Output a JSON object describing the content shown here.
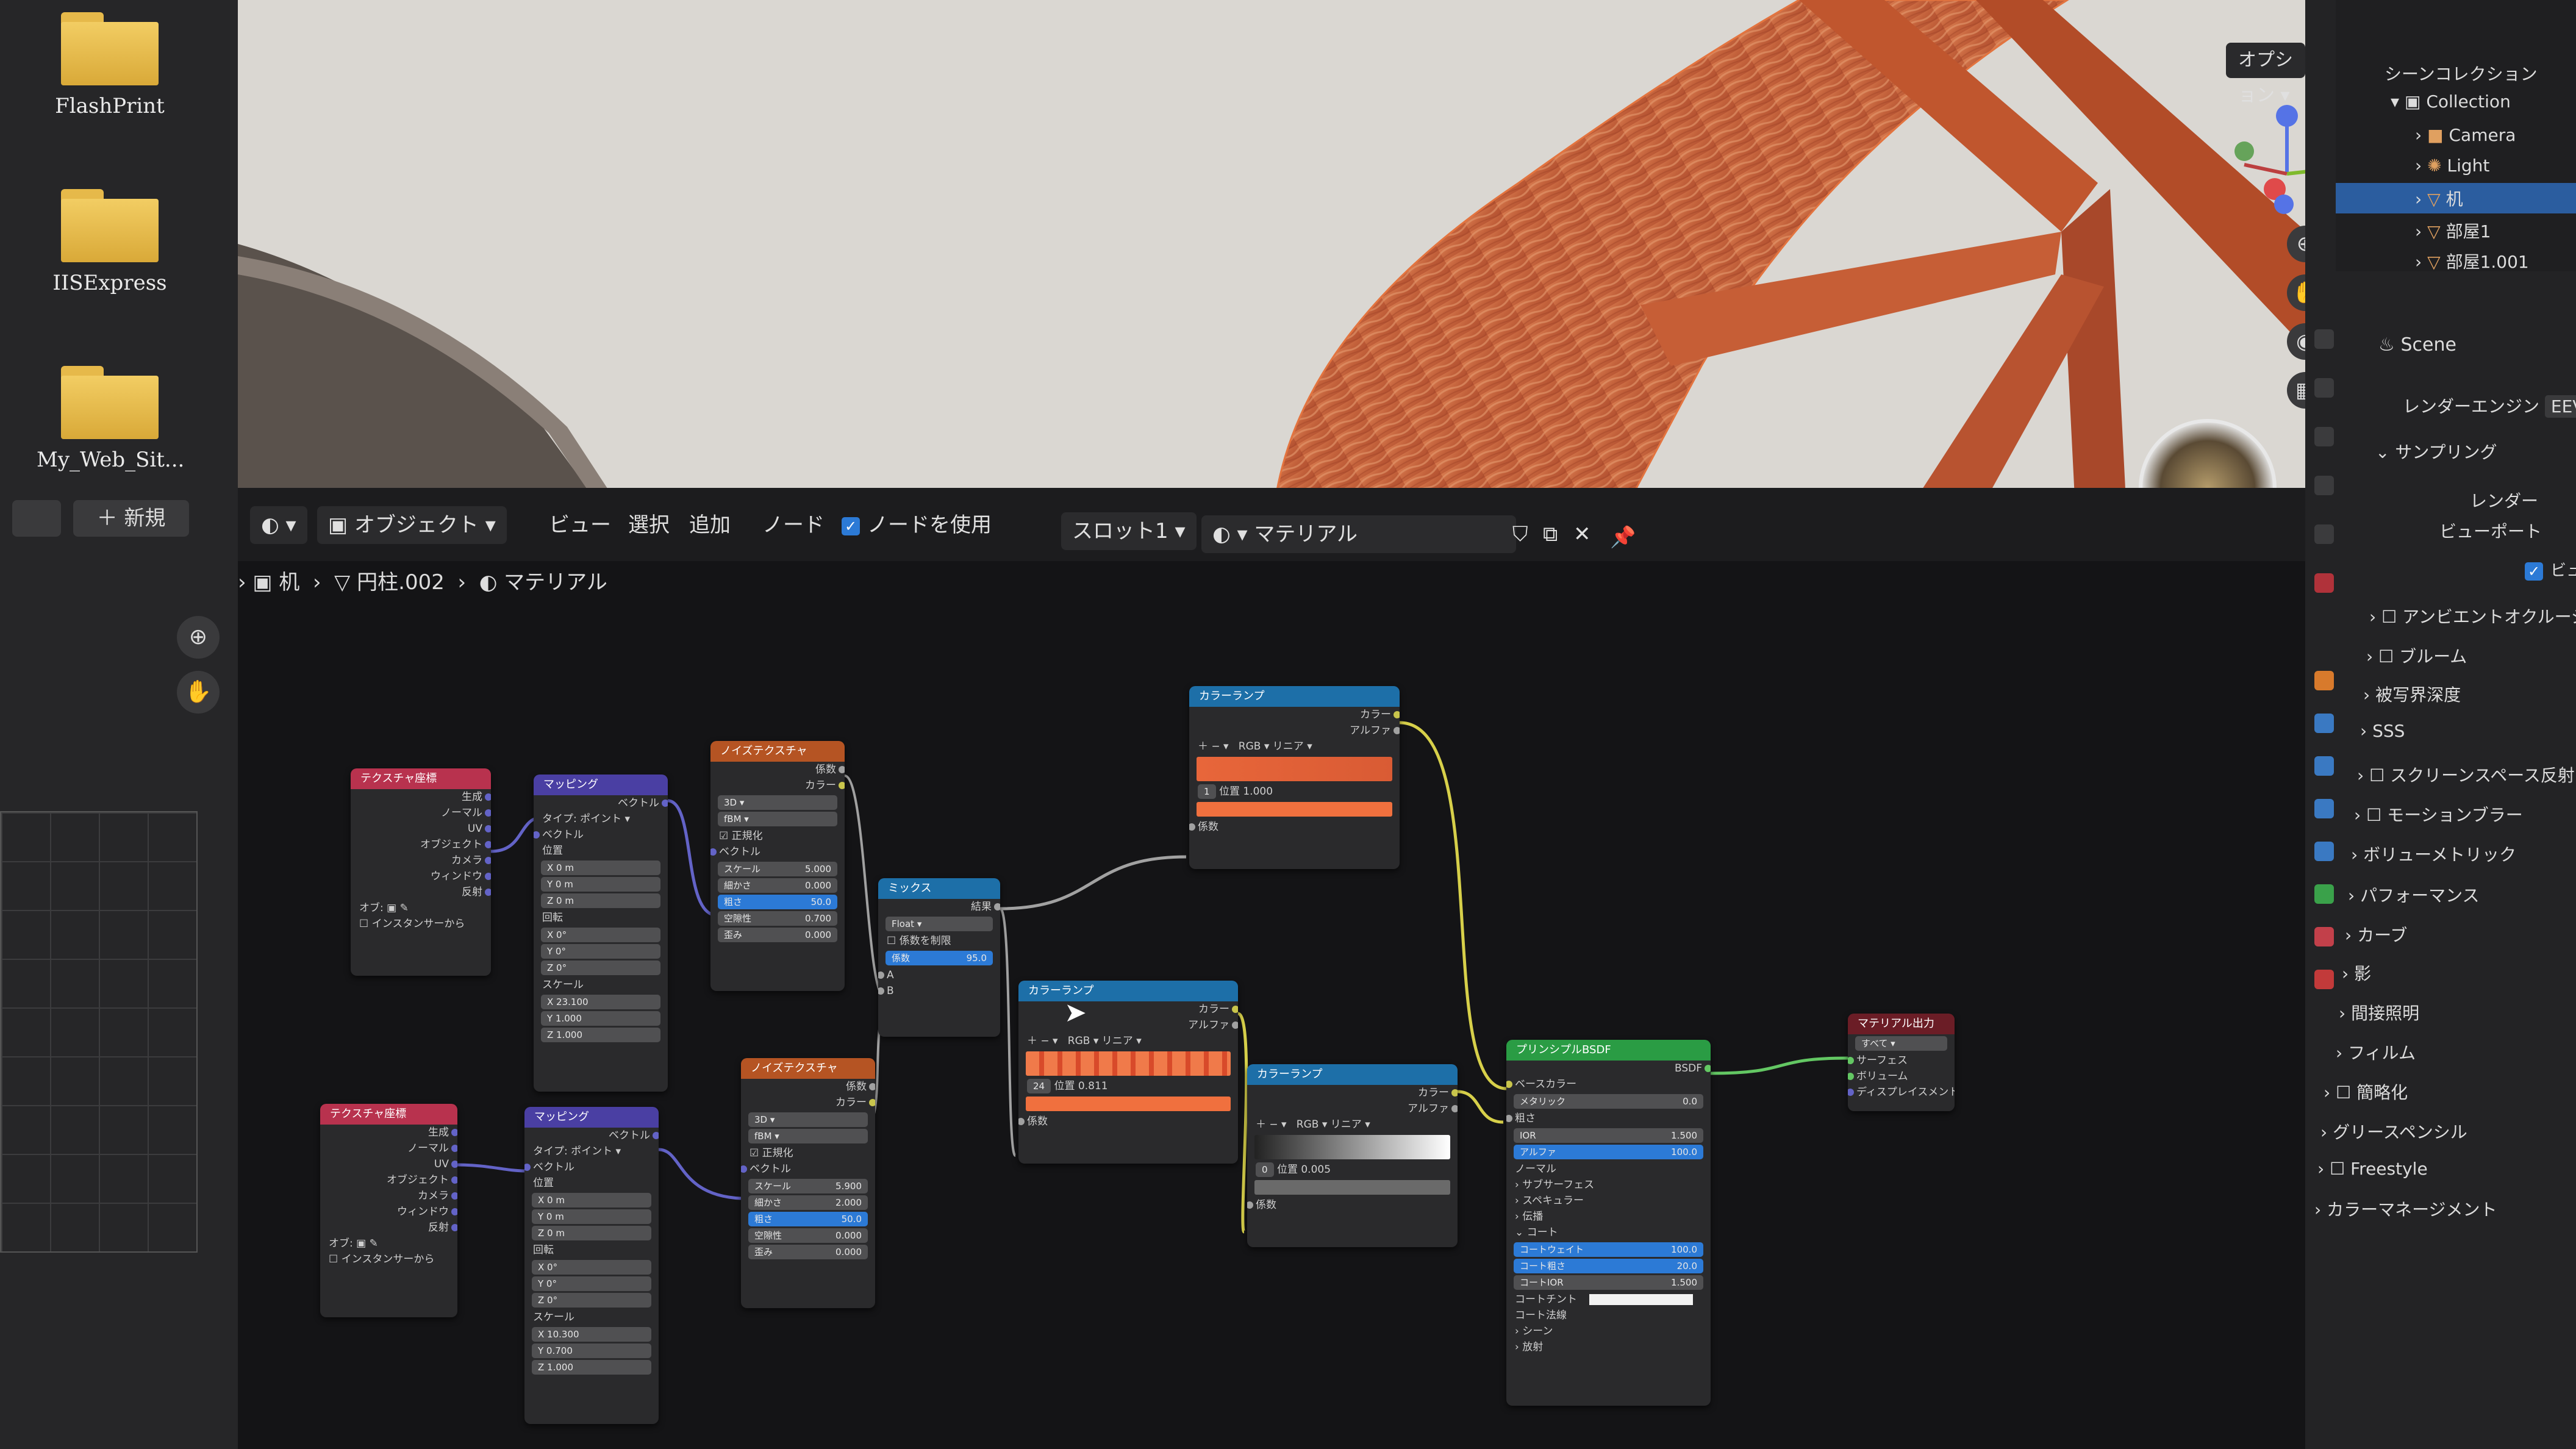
{
  "desktop": {
    "icons": [
      {
        "label": "FlashPrint"
      },
      {
        "label": "IISExpress"
      },
      {
        "label": "My_Web_Sit..."
      }
    ]
  },
  "viewport": {
    "options_label": "オプション"
  },
  "node_editor": {
    "new_label": "新規",
    "mode_label": "オブジェクト",
    "menus": [
      "ビュー",
      "選択",
      "追加",
      "ノード"
    ],
    "use_nodes_label": "ノードを使用",
    "slot_label": "スロット1",
    "material_name": "マテリアル",
    "breadcrumb": [
      "机",
      "円柱.002",
      "マテリアル"
    ]
  },
  "nodes": {
    "tex_coord_1": {
      "title": "テクスチャ座標",
      "outputs": [
        "生成",
        "ノーマル",
        "UV",
        "オブジェクト",
        "カメラ",
        "ウィンドウ",
        "反射"
      ],
      "object_label": "オブ",
      "instancer_label": "インスタンサーから"
    },
    "mapping_1": {
      "title": "マッピング",
      "out": "ベクトル",
      "type_label": "タイプ",
      "type_value": "ポイント",
      "vector_label": "ベクトル",
      "location_label": "位置",
      "loc": [
        "X  0 m",
        "Y  0 m",
        "Z  0 m"
      ],
      "rotation_label": "回転",
      "rot": [
        "X  0°",
        "Y  0°",
        "Z  0°"
      ],
      "scale_label": "スケール",
      "scale": [
        "X  23.100",
        "Y  1.000",
        "Z  1.000"
      ]
    },
    "noise_1": {
      "title": "ノイズテクスチャ",
      "outputs": [
        "係数",
        "カラー"
      ],
      "dim": "3D",
      "type": "fBM",
      "normalize": "正規化",
      "vector": "ベクトル",
      "fields": [
        {
          "label": "スケール",
          "value": "5.000"
        },
        {
          "label": "細かさ",
          "value": "0.000"
        },
        {
          "label": "粗さ",
          "value": "50.0",
          "hl": true
        },
        {
          "label": "空隙性",
          "value": "0.700"
        },
        {
          "label": "歪み",
          "value": "0.000"
        }
      ]
    },
    "mix": {
      "title": "ミックス",
      "out": "結果",
      "type": "Float",
      "clamp": "係数を制限",
      "factor_label": "係数",
      "factor_value": "95.0",
      "inputs": [
        "A",
        "B"
      ]
    },
    "ramp_top": {
      "title": "カラーランプ",
      "outputs": [
        "カラー",
        "アルファ"
      ],
      "mode": "RGB",
      "interp": "リニア",
      "index": "1",
      "pos_label": "位置",
      "pos": "1.000",
      "in": "係数"
    },
    "ramp_mid": {
      "title": "カラーランプ",
      "outputs": [
        "カラー",
        "アルファ"
      ],
      "mode": "RGB",
      "interp": "リニア",
      "index": "24",
      "pos_label": "位置",
      "pos": "0.811",
      "in": "係数"
    },
    "ramp_right": {
      "title": "カラーランプ",
      "outputs": [
        "カラー",
        "アルファ"
      ],
      "mode": "RGB",
      "interp": "リニア",
      "index": "0",
      "pos_label": "位置",
      "pos": "0.005",
      "in": "係数"
    },
    "tex_coord_2": {
      "title": "テクスチャ座標",
      "outputs": [
        "生成",
        "ノーマル",
        "UV",
        "オブジェクト",
        "カメラ",
        "ウィンドウ",
        "反射"
      ],
      "object_label": "オブ",
      "instancer_label": "インスタンサーから"
    },
    "mapping_2": {
      "title": "マッピング",
      "out": "ベクトル",
      "type_label": "タイプ",
      "type_value": "ポイント",
      "vector_label": "ベクトル",
      "location_label": "位置",
      "loc": [
        "X  0 m",
        "Y  0 m",
        "Z  0 m"
      ],
      "rotation_label": "回転",
      "rot": [
        "X  0°",
        "Y  0°",
        "Z  0°"
      ],
      "scale_label": "スケール",
      "scale": [
        "X  10.300",
        "Y  0.700",
        "Z  1.000"
      ]
    },
    "noise_2": {
      "title": "ノイズテクスチャ",
      "outputs": [
        "係数",
        "カラー"
      ],
      "dim": "3D",
      "type": "fBM",
      "normalize": "正規化",
      "vector": "ベクトル",
      "fields": [
        {
          "label": "スケール",
          "value": "5.900"
        },
        {
          "label": "細かさ",
          "value": "2.000"
        },
        {
          "label": "粗さ",
          "value": "50.0",
          "hl": true
        },
        {
          "label": "空隙性",
          "value": "0.000"
        },
        {
          "label": "歪み",
          "value": "0.000"
        }
      ]
    },
    "bsdf": {
      "title": "プリンシプルBSDF",
      "out": "BSDF",
      "base_color": "ベースカラー",
      "fields": [
        {
          "label": "メタリック",
          "value": "0.0"
        },
        {
          "label": "粗さ",
          "value": ""
        },
        {
          "label": "IOR",
          "value": "1.500"
        },
        {
          "label": "アルファ",
          "value": "100.0",
          "hl": true
        }
      ],
      "sections": [
        "ノーマル",
        "サブサーフェス",
        "スペキュラー",
        "伝播",
        "コート"
      ],
      "coat": [
        {
          "label": "コートウェイト",
          "value": "100.0",
          "hl": true
        },
        {
          "label": "コート粗さ",
          "value": "20.0",
          "hl": true
        },
        {
          "label": "コートIOR",
          "value": "1.500"
        }
      ],
      "coat_tint": "コートチント",
      "coat_normal": "コート法線",
      "more": [
        "シーン",
        "放射"
      ]
    },
    "output": {
      "title": "マテリアル出力",
      "target": "すべて",
      "inputs": [
        "サーフェス",
        "ボリューム",
        "ディスプレイスメント"
      ]
    }
  },
  "outliner": {
    "title": "シーンコレクション",
    "items": [
      {
        "label": "Collection"
      },
      {
        "label": "Camera"
      },
      {
        "label": "Light"
      },
      {
        "label": "机"
      },
      {
        "label": "部屋1"
      },
      {
        "label": "部屋1.001"
      }
    ]
  },
  "properties": {
    "scene_label": "Scene",
    "render_engine_label": "レンダーエンジン",
    "render_engine_value": "EEV",
    "sampling_label": "サンプリング",
    "render_label": "レンダー",
    "viewport_label": "ビューポート",
    "preview_label": "ビュ",
    "panels": [
      "アンビエントオクルージョン",
      "ブルーム",
      "被写界深度",
      "SSS",
      "スクリーンスペース反射",
      "モーションブラー",
      "ボリューメトリック",
      "パフォーマンス",
      "カーブ",
      "影",
      "間接照明",
      "フィルム",
      "簡略化",
      "グリースペンシル",
      "Freestyle",
      "カラーマネージメント"
    ]
  },
  "colors": {
    "accent": "#2c7ad6",
    "wood": "#c2603a",
    "orange_ramp": "#f0703e"
  }
}
